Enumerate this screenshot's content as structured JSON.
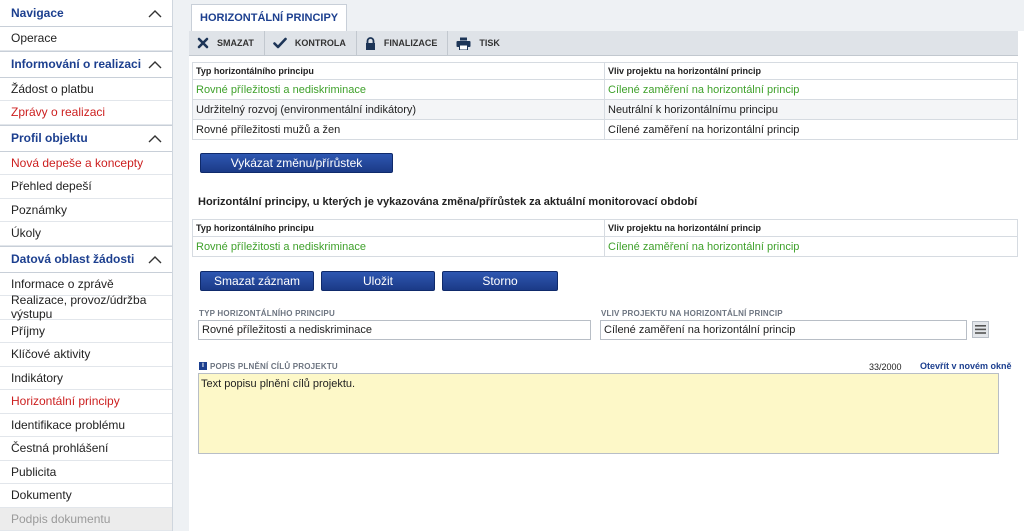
{
  "sidebar": {
    "sections": [
      {
        "title": "Navigace",
        "items": [
          {
            "label": "Operace",
            "style": "normal"
          }
        ]
      },
      {
        "title": "Informování o realizaci",
        "items": [
          {
            "label": "Žádost o platbu",
            "style": "normal"
          },
          {
            "label": "Zprávy o realizaci",
            "style": "red"
          }
        ]
      },
      {
        "title": "Profil objektu",
        "items": [
          {
            "label": "Nová depeše a koncepty",
            "style": "red"
          },
          {
            "label": "Přehled depeší",
            "style": "normal"
          },
          {
            "label": "Poznámky",
            "style": "normal"
          },
          {
            "label": "Úkoly",
            "style": "normal"
          }
        ]
      },
      {
        "title": "Datová oblast žádosti",
        "items": [
          {
            "label": "Informace o zprávě",
            "style": "normal"
          },
          {
            "label": "Realizace, provoz/údržba výstupu",
            "style": "normal"
          },
          {
            "label": "Příjmy",
            "style": "normal"
          },
          {
            "label": "Klíčové aktivity",
            "style": "normal"
          },
          {
            "label": "Indikátory",
            "style": "normal"
          },
          {
            "label": "Horizontální principy",
            "style": "red"
          },
          {
            "label": "Identifikace problému",
            "style": "normal"
          },
          {
            "label": "Čestná prohlášení",
            "style": "normal"
          },
          {
            "label": "Publicita",
            "style": "normal"
          },
          {
            "label": "Dokumenty",
            "style": "normal"
          },
          {
            "label": "Podpis dokumentu",
            "style": "grey"
          }
        ]
      }
    ]
  },
  "tab": {
    "label": "HORIZONTÁLNÍ PRINCIPY"
  },
  "toolbar": {
    "delete": "SMAZAT",
    "check": "KONTROLA",
    "finalize": "FINALIZACE",
    "print": "TISK"
  },
  "table1": {
    "headers": [
      "Typ horizontálního principu",
      "Vliv projektu na horizontální princip"
    ],
    "rows": [
      {
        "type": "Rovné příležitosti a nediskriminace",
        "impact": "Cílené zaměření na horizontální princip",
        "selected": true
      },
      {
        "type": "Udržitelný rozvoj (environmentální indikátory)",
        "impact": "Neutrální k horizontálnímu principu",
        "selected": false
      },
      {
        "type": "Rovné příležitosti mužů a žen",
        "impact": "Cílené zaměření na horizontální princip",
        "selected": false
      }
    ]
  },
  "report_change_button": "Vykázat změnu/přírůstek",
  "section2_title": "Horizontální principy, u kterých je vykazována změna/přírůstek za aktuální monitorovací období",
  "table2": {
    "headers": [
      "Typ horizontálního principu",
      "Vliv projektu na horizontální princip"
    ],
    "rows": [
      {
        "type": "Rovné příležitosti a nediskriminace",
        "impact": "Cílené zaměření na horizontální princip",
        "selected": true
      }
    ]
  },
  "actions": {
    "delete_record": "Smazat záznam",
    "save": "Uložit",
    "cancel": "Storno"
  },
  "form": {
    "type_label": "TYP HORIZONTÁLNÍHO PRINCIPU",
    "type_value": "Rovné příležitosti a nediskriminace",
    "impact_label": "VLIV PROJEKTU NA HORIZONTÁLNÍ PRINCIP",
    "impact_value": "Cílené zaměření na horizontální princip",
    "description_label": "POPIS PLNĚNÍ CÍLŮ PROJEKTU",
    "description_value": "Text popisu plnění cílů projektu.",
    "counter": "33/2000",
    "open_new_window": "Otevřít v novém okně"
  },
  "colors": {
    "accent_blue": "#1c3f8f",
    "selected_green": "#3fa12b",
    "red_link": "#cc1f1f",
    "textarea_bg": "#fdf8c8"
  }
}
